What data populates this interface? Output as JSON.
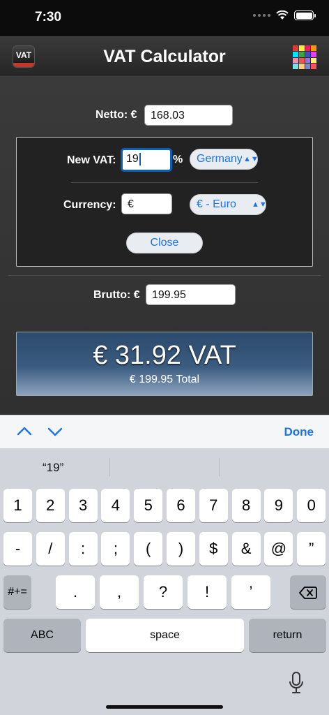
{
  "status": {
    "time": "7:30"
  },
  "nav": {
    "title": "VAT Calculator",
    "logo_text": "VAT"
  },
  "form": {
    "netto_label": "Netto: €",
    "netto_value": "168.03",
    "vat_label": "New VAT:",
    "vat_value": "19",
    "percent_sign": "%",
    "country": "Germany",
    "currency_label": "Currency:",
    "currency_symbol": "€",
    "currency_name": "€ - Euro",
    "close_label": "Close",
    "brutto_label": "Brutto: €",
    "brutto_value": "199.95"
  },
  "result": {
    "vat_text": "€ 31.92 VAT",
    "total_text": "€ 199.95 Total"
  },
  "accessory": {
    "done_label": "Done"
  },
  "keyboard": {
    "suggestion": "“19”",
    "row1": [
      "1",
      "2",
      "3",
      "4",
      "5",
      "6",
      "7",
      "8",
      "9",
      "0"
    ],
    "row2": [
      "-",
      "/",
      ":",
      ";",
      "(",
      ")",
      "$",
      "&",
      "@",
      "”"
    ],
    "row3": [
      ".",
      ",",
      "?",
      "!",
      "’"
    ],
    "shift_label": "#+=",
    "abc_label": "ABC",
    "space_label": "space",
    "return_label": "return"
  },
  "colors": {
    "accent": "#1a73e8",
    "result_top": "#2b4a6c",
    "result_bottom": "#8da3bf",
    "palette": [
      "#e53935",
      "#ffeb3b",
      "#e91e63",
      "#ff9800",
      "#00e5ff",
      "#43a047",
      "#3f51b5",
      "#e040fb",
      "#f48fb1",
      "#ef5350",
      "#9575cd",
      "#fff176",
      "#80deea",
      "#ffcc80",
      "#7986cb",
      "#ff5252"
    ]
  }
}
